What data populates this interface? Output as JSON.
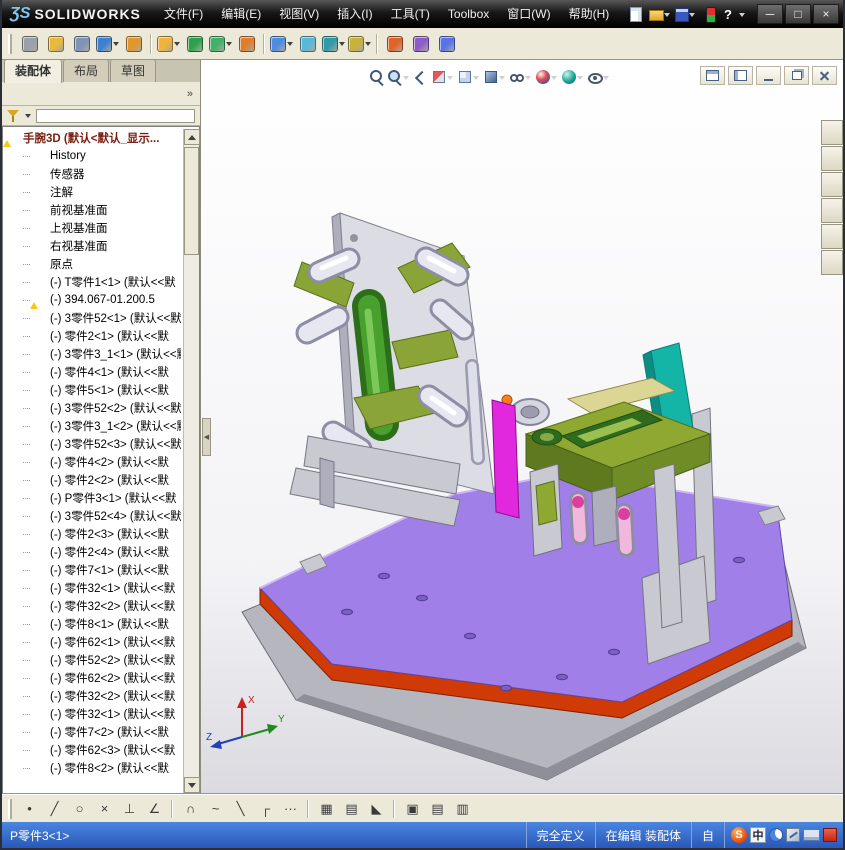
{
  "titlebar": {
    "logo_mark": "ƷS",
    "logo_text": "SOLIDWORKS",
    "menus": [
      "文件(F)",
      "编辑(E)",
      "视图(V)",
      "插入(I)",
      "工具(T)",
      "Toolbox",
      "窗口(W)",
      "帮助(H)"
    ],
    "quick_icons": [
      {
        "name": "new-document-icon",
        "kind": "doc",
        "dd": false
      },
      {
        "name": "open-document-icon",
        "kind": "folder2",
        "dd": true
      },
      {
        "name": "save-icon",
        "kind": "save",
        "dd": true
      },
      {
        "name": "lifecycle-icon",
        "kind": "traffic",
        "dd": false
      },
      {
        "name": "help-icon",
        "kind": "help",
        "g": "?",
        "dd": true
      }
    ],
    "window_buttons": [
      {
        "name": "minimize-button",
        "g": "─"
      },
      {
        "name": "restore-button",
        "g": "□"
      },
      {
        "name": "close-button",
        "g": "×"
      }
    ]
  },
  "toolbar2": {
    "items": [
      {
        "name": "select-tool-icon",
        "c": "#9aa0a8"
      },
      {
        "name": "sketch-tool-icon",
        "c": "#e8b93c"
      },
      {
        "name": "attachment-icon",
        "c": "#7f93b4"
      },
      {
        "name": "design-table-icon",
        "c": "#3f7fd0",
        "dd": true
      },
      {
        "name": "equations-icon",
        "c": "#e0972c"
      },
      {
        "name": "insert-component-icon",
        "c": "#f0b43c",
        "dd": true,
        "sep": true
      },
      {
        "name": "mate-icon",
        "c": "#2fa14c"
      },
      {
        "name": "component-pattern-icon",
        "c": "#43b06a",
        "dd": true
      },
      {
        "name": "smart-fasteners-icon",
        "c": "#e07e30"
      },
      {
        "name": "move-component-icon",
        "c": "#4f8ce0",
        "dd": true,
        "sep": true
      },
      {
        "name": "show-hidden-components-icon",
        "c": "#58b8d8"
      },
      {
        "name": "assembly-features-icon",
        "c": "#2f9aa8",
        "dd": true
      },
      {
        "name": "reference-geometry-icon",
        "c": "#c8b23c",
        "dd": true
      },
      {
        "name": "exploded-view-icon",
        "c": "#e06428",
        "sep": true
      },
      {
        "name": "interference-detection-icon",
        "c": "#8c5cc8"
      },
      {
        "name": "motion-study-icon",
        "c": "#5874e8"
      }
    ]
  },
  "panel": {
    "tabs": [
      {
        "label": "装配体",
        "active": true
      },
      {
        "label": "布局",
        "active": false
      },
      {
        "label": "草图",
        "active": false
      }
    ],
    "toolbar": [
      {
        "name": "featuremanager-tab-icon",
        "kind": "feat"
      },
      {
        "name": "propertymanager-tab-icon",
        "kind": "prop"
      },
      {
        "name": "configurationmanager-tab-icon",
        "kind": "config"
      },
      {
        "name": "displaymanager-tab-icon",
        "kind": "display"
      }
    ],
    "overflow_glyph": "»",
    "splitter_glyph": "◀"
  },
  "tree": {
    "items": [
      {
        "icon": "root",
        "root": true,
        "warn": true,
        "label": "手腕3D (默认<默认_显示..."
      },
      {
        "icon": "history",
        "label": "History"
      },
      {
        "icon": "sensors",
        "label": "传感器"
      },
      {
        "icon": "ann",
        "label": "注解"
      },
      {
        "icon": "plane",
        "label": "前视基准面"
      },
      {
        "icon": "plane",
        "label": "上视基准面"
      },
      {
        "icon": "plane",
        "label": "右视基准面"
      },
      {
        "icon": "origin",
        "label": "原点"
      },
      {
        "icon": "part",
        "label": "(-) T零件1<1> (默认<<默"
      },
      {
        "icon": "part",
        "warn": true,
        "label": "(-) 394.067-01.200.5"
      },
      {
        "icon": "part",
        "label": "(-) 3零件52<1> (默认<<默"
      },
      {
        "icon": "part",
        "label": "(-) 零件2<1> (默认<<默"
      },
      {
        "icon": "part",
        "label": "(-) 3零件3_1<1> (默认<<默"
      },
      {
        "icon": "part",
        "label": "(-) 零件4<1> (默认<<默"
      },
      {
        "icon": "part",
        "label": "(-) 零件5<1> (默认<<默"
      },
      {
        "icon": "part",
        "label": "(-) 3零件52<2> (默认<<默"
      },
      {
        "icon": "part",
        "label": "(-) 3零件3_1<2> (默认<<默"
      },
      {
        "icon": "part",
        "label": "(-) 3零件52<3> (默认<<默"
      },
      {
        "icon": "part",
        "label": "(-) 零件4<2> (默认<<默"
      },
      {
        "icon": "part",
        "label": "(-) 零件2<2> (默认<<默"
      },
      {
        "icon": "part",
        "label": "(-) P零件3<1> (默认<<默"
      },
      {
        "icon": "part",
        "label": "(-) 3零件52<4> (默认<<默"
      },
      {
        "icon": "part",
        "label": "(-) 零件2<3> (默认<<默"
      },
      {
        "icon": "part",
        "label": "(-) 零件2<4> (默认<<默"
      },
      {
        "icon": "part",
        "label": "(-) 零件7<1> (默认<<默"
      },
      {
        "icon": "part",
        "label": "(-) 零件32<1> (默认<<默"
      },
      {
        "icon": "part",
        "label": "(-) 零件32<2> (默认<<默"
      },
      {
        "icon": "part",
        "label": "(-) 零件8<1> (默认<<默"
      },
      {
        "icon": "part",
        "label": "(-) 零件62<1> (默认<<默"
      },
      {
        "icon": "part",
        "label": "(-) 零件52<2> (默认<<默"
      },
      {
        "icon": "part",
        "label": "(-) 零件62<2> (默认<<默"
      },
      {
        "icon": "part",
        "label": "(-) 零件32<2> (默认<<默"
      },
      {
        "icon": "part",
        "label": "(-) 零件32<1> (默认<<默"
      },
      {
        "icon": "part",
        "label": "(-) 零件7<2> (默认<<默"
      },
      {
        "icon": "part",
        "label": "(-) 零件62<3> (默认<<默"
      },
      {
        "icon": "part",
        "label": "(-) 零件8<2> (默认<<默"
      }
    ]
  },
  "headsup": {
    "items": [
      {
        "name": "zoom-fit-icon",
        "kind": "mag"
      },
      {
        "name": "zoom-area-icon",
        "kind": "magplus",
        "dd": true
      },
      {
        "name": "previous-view-icon",
        "kind": "prev"
      },
      {
        "name": "section-view-icon",
        "kind": "section",
        "dd": true
      },
      {
        "name": "view-orientation-icon",
        "kind": "cube",
        "dd": true
      },
      {
        "name": "display-style-icon",
        "kind": "shaded",
        "dd": true
      },
      {
        "name": "hide-show-items-icon",
        "kind": "glasses",
        "dd": true
      },
      {
        "name": "edit-appearance-icon",
        "kind": "ball",
        "dd": true
      },
      {
        "name": "apply-scene-icon",
        "kind": "scene",
        "dd": true
      },
      {
        "name": "view-settings-icon",
        "kind": "eye",
        "dd": true
      }
    ]
  },
  "mdi": {
    "buttons": [
      {
        "name": "tile-horizontal-button",
        "kind": "tileh"
      },
      {
        "name": "tile-vertical-button",
        "kind": "tilev"
      },
      {
        "name": "minimize-doc-button",
        "kind": "min"
      },
      {
        "name": "restore-doc-button",
        "kind": "rest"
      },
      {
        "name": "close-doc-button",
        "kind": "close"
      }
    ]
  },
  "taskpane": {
    "items": [
      {
        "name": "solidworks-resources-icon",
        "kind": "home"
      },
      {
        "name": "design-library-icon",
        "kind": "library"
      },
      {
        "name": "file-explorer-icon",
        "kind": "folder"
      },
      {
        "name": "view-palette-icon",
        "kind": "palette"
      },
      {
        "name": "appearances-icon",
        "kind": "globe"
      },
      {
        "name": "custom-properties-icon",
        "kind": "props"
      }
    ]
  },
  "toolbar3": {
    "items": [
      {
        "name": "point-tool-icon",
        "g": "•"
      },
      {
        "name": "line-tool-icon",
        "g": "╱"
      },
      {
        "name": "circle-tool-icon",
        "g": "○"
      },
      {
        "name": "erase-tool-icon",
        "g": "×"
      },
      {
        "name": "perpendicular-tool-icon",
        "g": "⊥"
      },
      {
        "name": "angle-tool-icon",
        "g": "∠"
      },
      {
        "name": "arc-tool-icon",
        "g": "∩",
        "sep": true
      },
      {
        "name": "spline-tool-icon",
        "g": "~"
      },
      {
        "name": "mirror-tool-icon",
        "g": "╲"
      },
      {
        "name": "corner-tool-icon",
        "g": "┌"
      },
      {
        "name": "more-tools-icon",
        "g": "···"
      },
      {
        "name": "grid-icon",
        "g": "▦",
        "sep": true
      },
      {
        "name": "snap-icon",
        "g": "▤"
      },
      {
        "name": "triangle-icon",
        "g": "◣"
      },
      {
        "name": "shaded-view-button",
        "g": "▣",
        "active": true,
        "sep": true
      },
      {
        "name": "split-view-button",
        "g": "▤"
      },
      {
        "name": "pane-view-button",
        "g": "▥"
      }
    ]
  },
  "statusbar": {
    "selection": "P零件3<1>",
    "define_state": "完全定义",
    "edit_state": "在编辑  装配体",
    "custom": "自",
    "ime": [
      {
        "name": "sogou-ime-icon",
        "kind": "sogou",
        "g": "S"
      },
      {
        "name": "ime-lang-indicator",
        "kind": "lang",
        "g": "中"
      },
      {
        "name": "ime-moon-icon",
        "kind": "moon"
      },
      {
        "name": "ime-pen-icon",
        "kind": "pen"
      },
      {
        "name": "ime-keyboard-icon",
        "kind": "keyboard"
      },
      {
        "name": "ime-toolbox-icon",
        "kind": "redbox"
      }
    ]
  },
  "model": {
    "triad": {
      "x": "X",
      "y": "Y",
      "z": "Z"
    },
    "palette": {
      "base_top": "#a080e8",
      "base_band": "#cf3a06",
      "base_bottom": "#b6b6be",
      "plate": "#dcdce4",
      "plate_side": "#aeaebc",
      "olive": "#8aa437",
      "green_cyl": "#48a12c",
      "green_cyl_dark": "#2c6e1a",
      "green_cyl_hi": "#7cc85a",
      "roller": "#e7e7f1",
      "roller_edge": "#8d8da4",
      "magenta": "#e228de",
      "orange_part": "#ff7d1e",
      "teal": "#14b4a6",
      "teal_dark": "#0e8d82",
      "yellow_plate": "#dcd694",
      "block_top": "#8fa832",
      "block_front": "#5f7a1e",
      "block_right": "#6f8c26",
      "block_detail": "#2e6b1e",
      "pink": "#f0b8dc",
      "pink_dark": "#d8409e",
      "post": "#c9c9d1",
      "hole": "#7a5fc2",
      "flange": "#d6d6e0",
      "triad_x": "#cc2020",
      "triad_y": "#1f8a1f",
      "triad_z": "#2040c0"
    }
  }
}
